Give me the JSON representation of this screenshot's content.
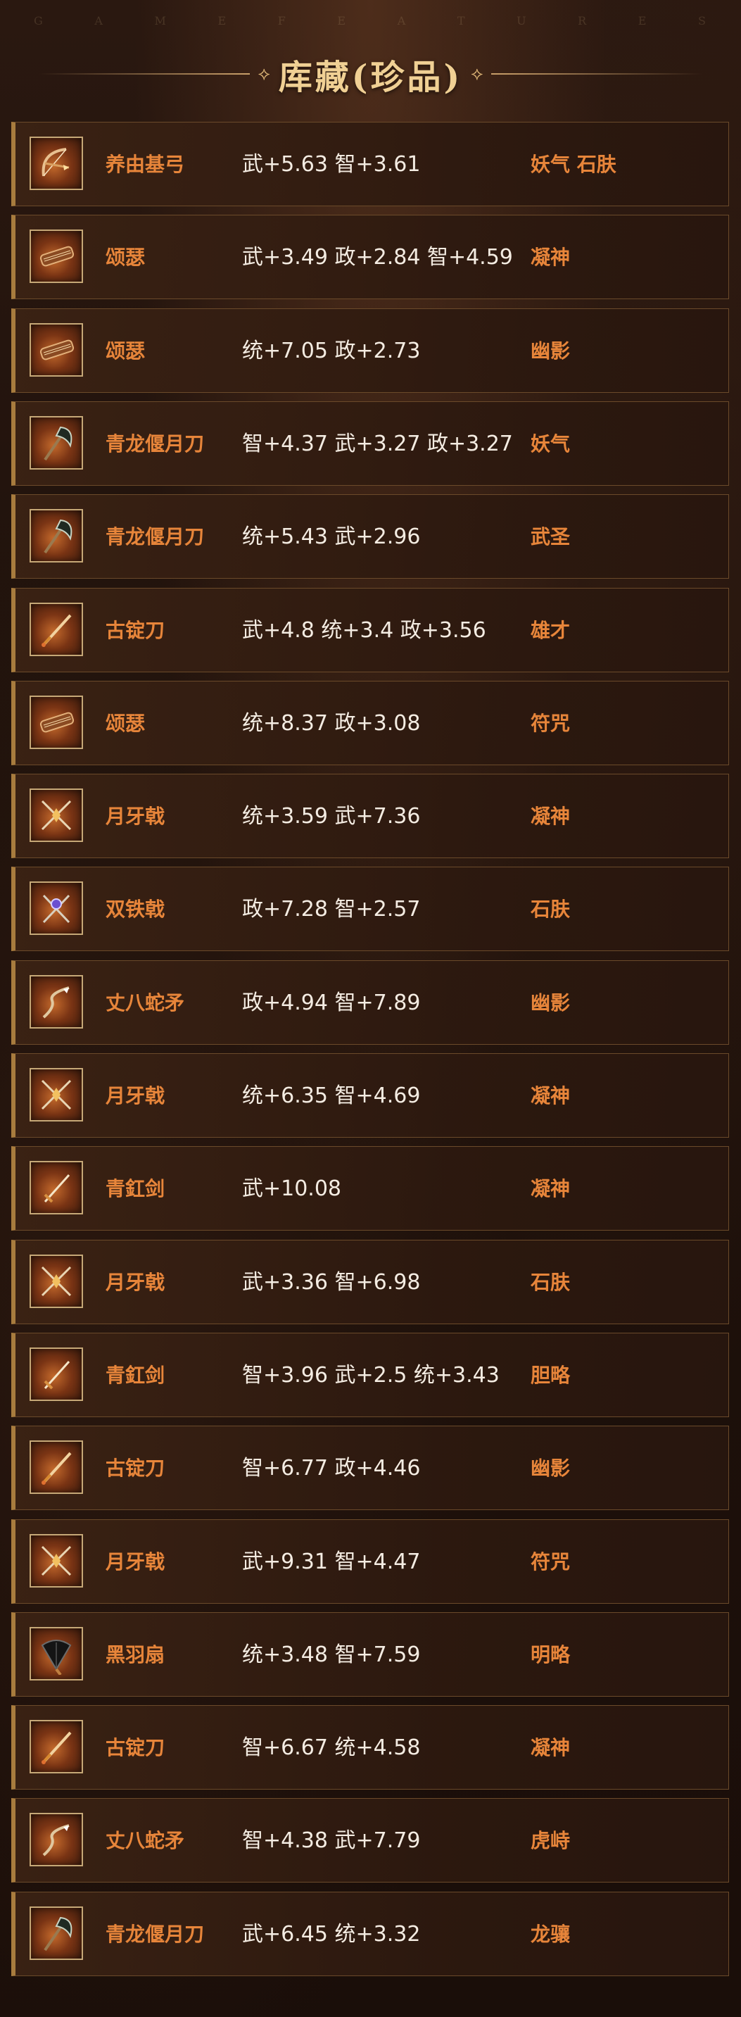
{
  "banner_letters": [
    "G",
    "A",
    "M",
    "E",
    "F",
    "E",
    "A",
    "T",
    "U",
    "R",
    "E",
    "S"
  ],
  "title": "库藏(珍品)",
  "title_ornament_left": "⟡",
  "title_ornament_right": "⟡",
  "colors": {
    "accent_text": "#e7853a",
    "stat_text": "#f4ece2",
    "title_text": "#f0d094",
    "row_border": "#6b4a2a",
    "icon_frame": "#c6a877"
  },
  "items": [
    {
      "name": "养由基弓",
      "stats": "武+5.63 智+3.61",
      "trait": "妖气 石肤",
      "icon": "bow-icon"
    },
    {
      "name": "颂瑟",
      "stats": "武+3.49 政+2.84 智+4.59",
      "trait": "凝神",
      "icon": "zither-icon"
    },
    {
      "name": "颂瑟",
      "stats": "统+7.05 政+2.73",
      "trait": "幽影",
      "icon": "zither-icon"
    },
    {
      "name": "青龙偃月刀",
      "stats": "智+4.37 武+3.27 政+3.27",
      "trait": "妖气",
      "icon": "glaive-icon"
    },
    {
      "name": "青龙偃月刀",
      "stats": "统+5.43 武+2.96",
      "trait": "武圣",
      "icon": "glaive-icon"
    },
    {
      "name": "古锭刀",
      "stats": "武+4.8 统+3.4 政+3.56",
      "trait": "雄才",
      "icon": "saber-icon"
    },
    {
      "name": "颂瑟",
      "stats": "统+8.37 政+3.08",
      "trait": "符咒",
      "icon": "zither-icon"
    },
    {
      "name": "月牙戟",
      "stats": "统+3.59 武+7.36",
      "trait": "凝神",
      "icon": "halberd-icon"
    },
    {
      "name": "双铁戟",
      "stats": "政+7.28 智+2.57",
      "trait": "石肤",
      "icon": "twin-halberd-icon"
    },
    {
      "name": "丈八蛇矛",
      "stats": "政+4.94 智+7.89",
      "trait": "幽影",
      "icon": "serpent-spear-icon"
    },
    {
      "name": "月牙戟",
      "stats": "统+6.35 智+4.69",
      "trait": "凝神",
      "icon": "halberd-icon"
    },
    {
      "name": "青釭剑",
      "stats": "武+10.08",
      "trait": "凝神",
      "icon": "sword-icon"
    },
    {
      "name": "月牙戟",
      "stats": "武+3.36 智+6.98",
      "trait": "石肤",
      "icon": "halberd-icon"
    },
    {
      "name": "青釭剑",
      "stats": "智+3.96 武+2.5 统+3.43",
      "trait": "胆略",
      "icon": "sword-icon"
    },
    {
      "name": "古锭刀",
      "stats": "智+6.77 政+4.46",
      "trait": "幽影",
      "icon": "saber-icon"
    },
    {
      "name": "月牙戟",
      "stats": "武+9.31 智+4.47",
      "trait": "符咒",
      "icon": "halberd-icon"
    },
    {
      "name": "黑羽扇",
      "stats": "统+3.48 智+7.59",
      "trait": "明略",
      "icon": "feather-fan-icon"
    },
    {
      "name": "古锭刀",
      "stats": "智+6.67 统+4.58",
      "trait": "凝神",
      "icon": "saber-icon"
    },
    {
      "name": "丈八蛇矛",
      "stats": "智+4.38 武+7.79",
      "trait": "虎峙",
      "icon": "serpent-spear-icon"
    },
    {
      "name": "青龙偃月刀",
      "stats": "武+6.45 统+3.32",
      "trait": "龙骧",
      "icon": "glaive-icon"
    }
  ]
}
